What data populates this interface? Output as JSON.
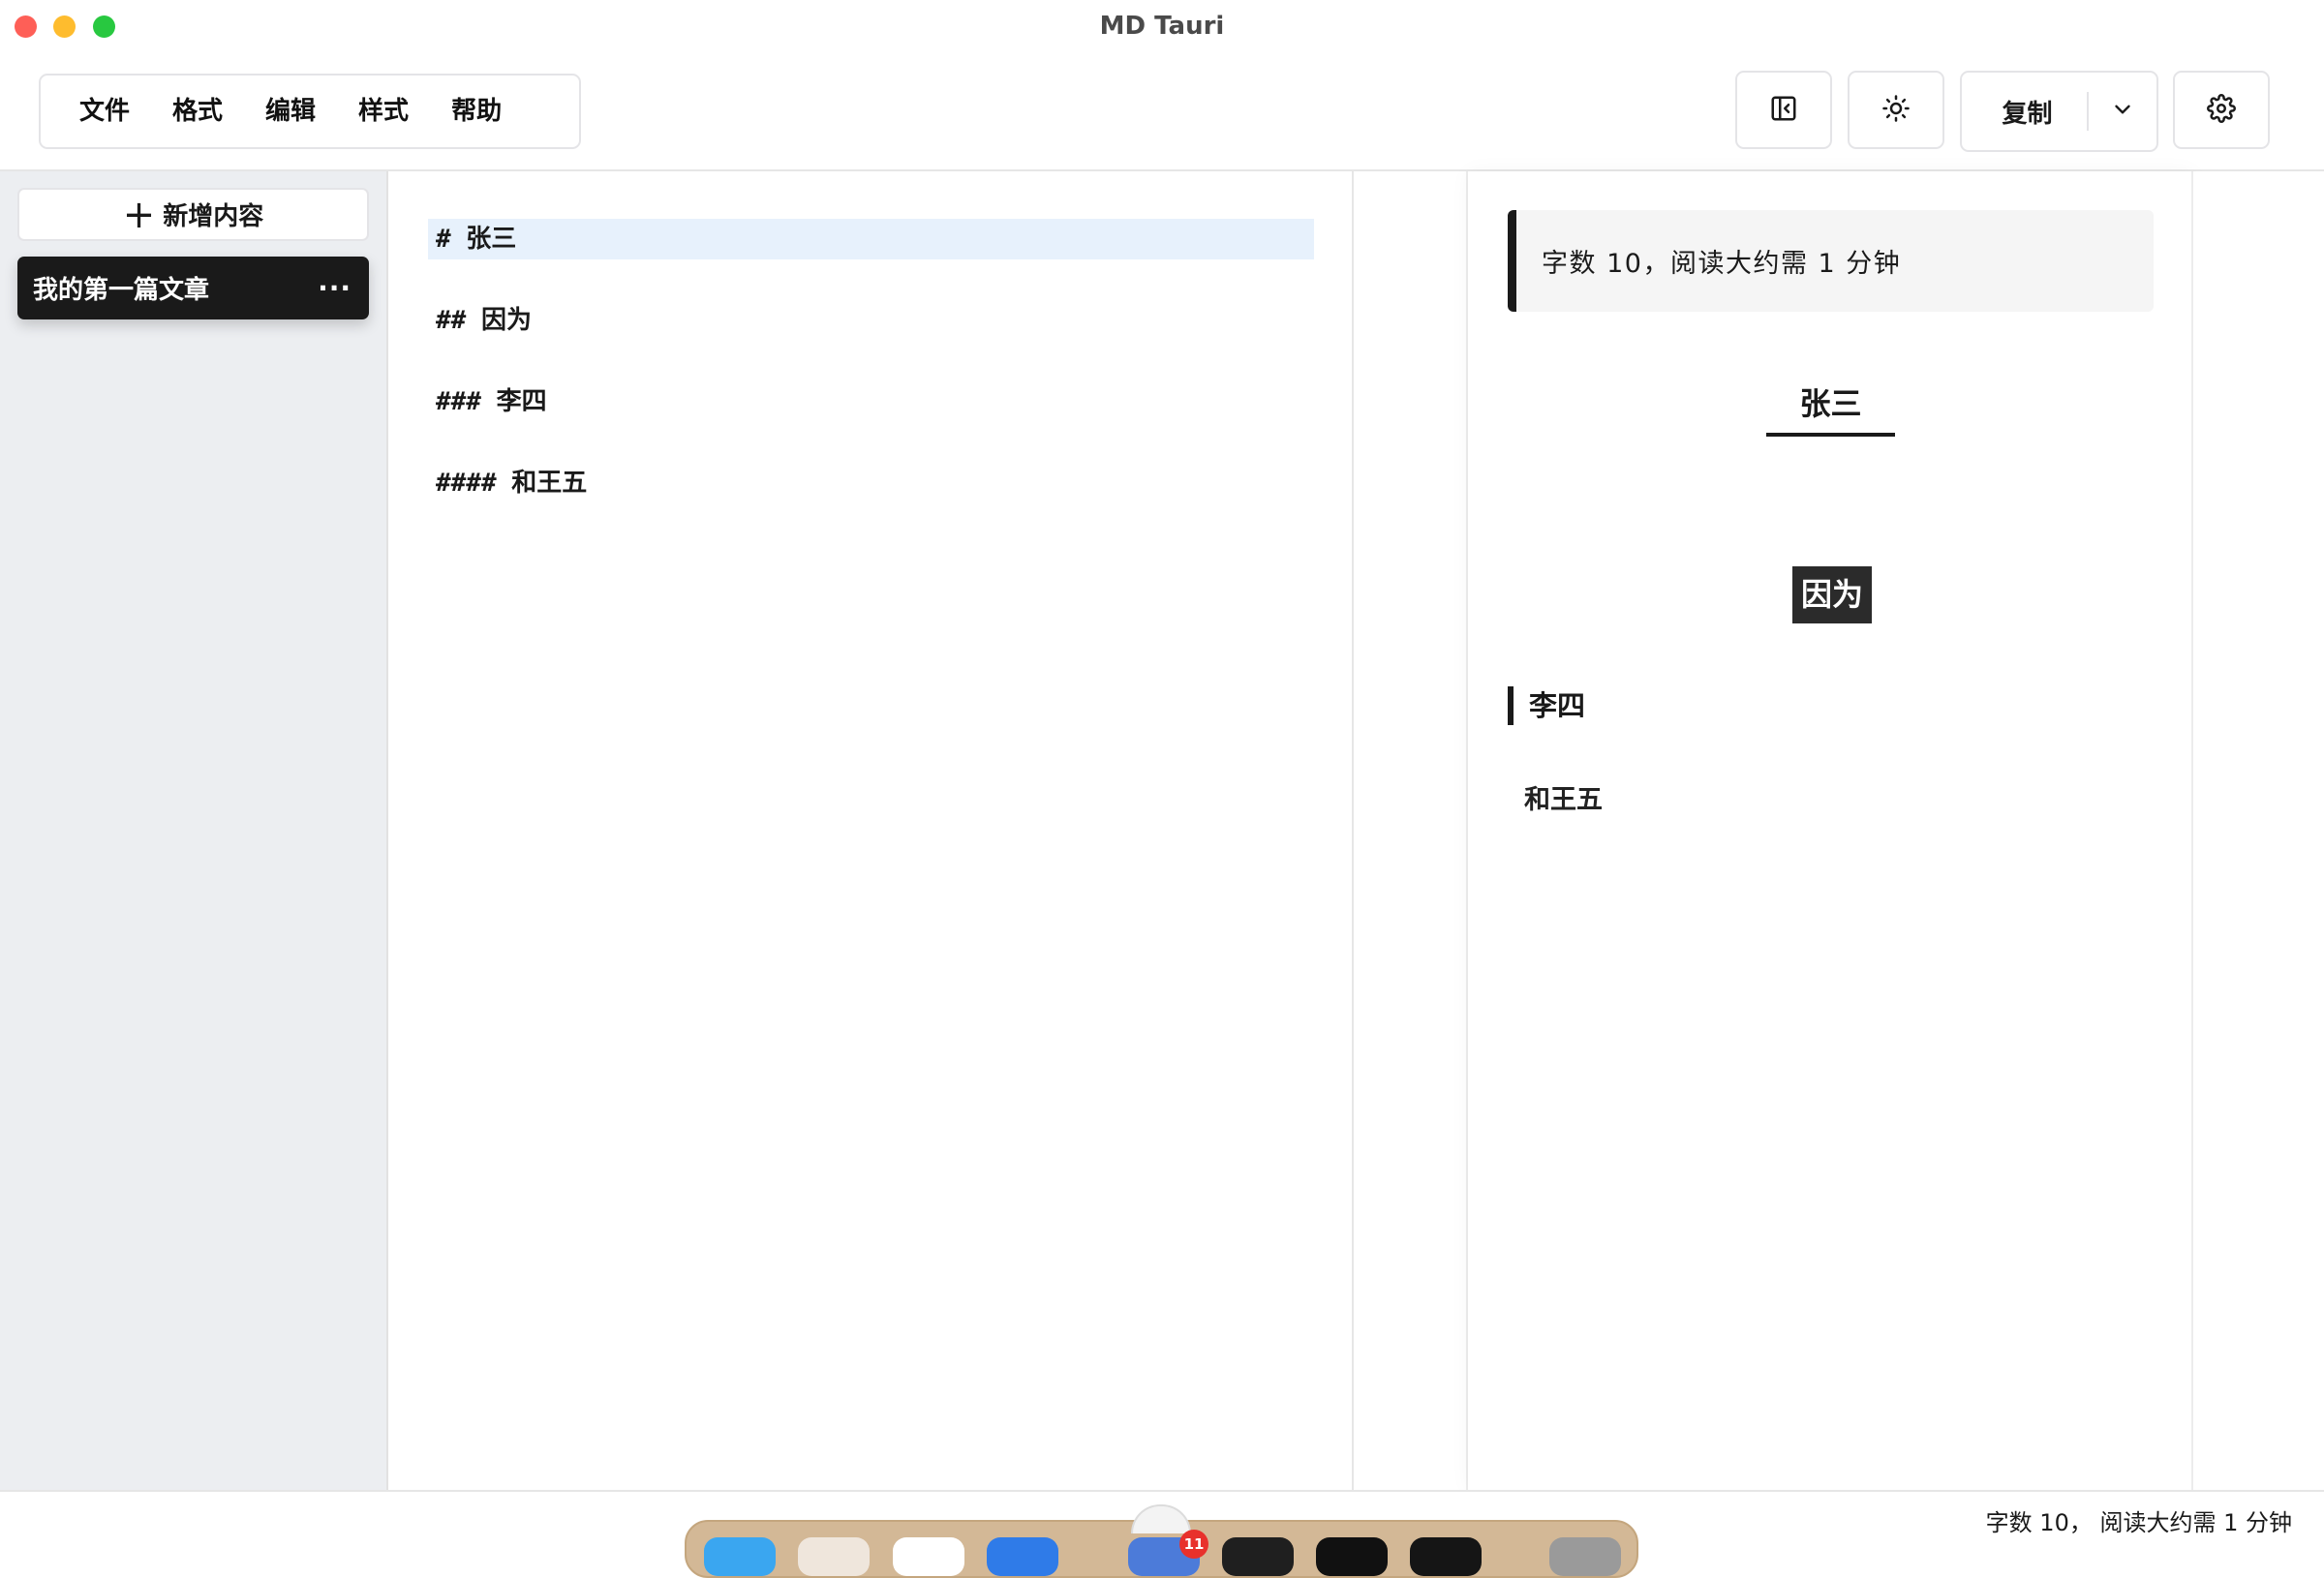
{
  "window": {
    "title": "MD Tauri"
  },
  "menu": {
    "items": [
      {
        "label": "文件"
      },
      {
        "label": "格式"
      },
      {
        "label": "编辑"
      },
      {
        "label": "样式"
      },
      {
        "label": "帮助"
      }
    ]
  },
  "toolbar": {
    "copy_label": "复制",
    "icons": {
      "sidebar_toggle": "sidebar-collapse-icon",
      "theme": "sun-icon",
      "dropdown": "chevron-down-icon",
      "settings": "gear-icon"
    }
  },
  "sidebar": {
    "new_button_label": "新增内容",
    "posts": [
      {
        "title": "我的第一篇文章",
        "more": "···",
        "active": true
      }
    ]
  },
  "editor": {
    "lines": [
      "# 张三",
      "## 因为",
      "### 李四",
      "#### 和王五"
    ],
    "active_line": 0
  },
  "preview": {
    "word_count_note": "字数 10，阅读大约需 1 分钟",
    "h1": "张三",
    "h2": "因为",
    "h3": "李四",
    "h4": "和王五"
  },
  "statusbar": {
    "text": "字数 10， 阅读大约需 1 分钟"
  },
  "colors": {
    "accent_dark": "#1a1a1a",
    "active_line": "#e7f1fc",
    "sidebar_bg": "#eceef1",
    "dock_badge": "#e8312c"
  },
  "dock": {
    "badge_count": "11"
  }
}
